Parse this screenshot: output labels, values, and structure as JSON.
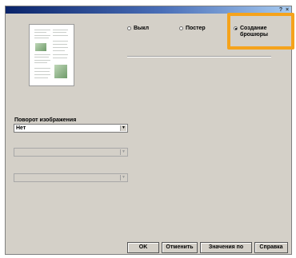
{
  "titlebar": {
    "help_label": "?",
    "close_label": "×"
  },
  "layout_options": [
    {
      "label": "Выкл",
      "checked": false
    },
    {
      "label": "Постер",
      "checked": false
    },
    {
      "label": "Создание\nброшюры",
      "checked": true
    }
  ],
  "rotation": {
    "label": "Поворот изображения",
    "value": "Нет"
  },
  "disabled_selects": [
    {
      "value": ""
    },
    {
      "value": ""
    }
  ],
  "buttons": {
    "ok": "OK",
    "cancel": "Отменить",
    "defaults": "Значения по",
    "help": "Справка"
  },
  "colors": {
    "highlight": "#f5a31c",
    "titlebar": "#0a246a"
  },
  "icons": [
    "radio-icon",
    "dropdown-arrow-icon",
    "page-preview-icon"
  ]
}
